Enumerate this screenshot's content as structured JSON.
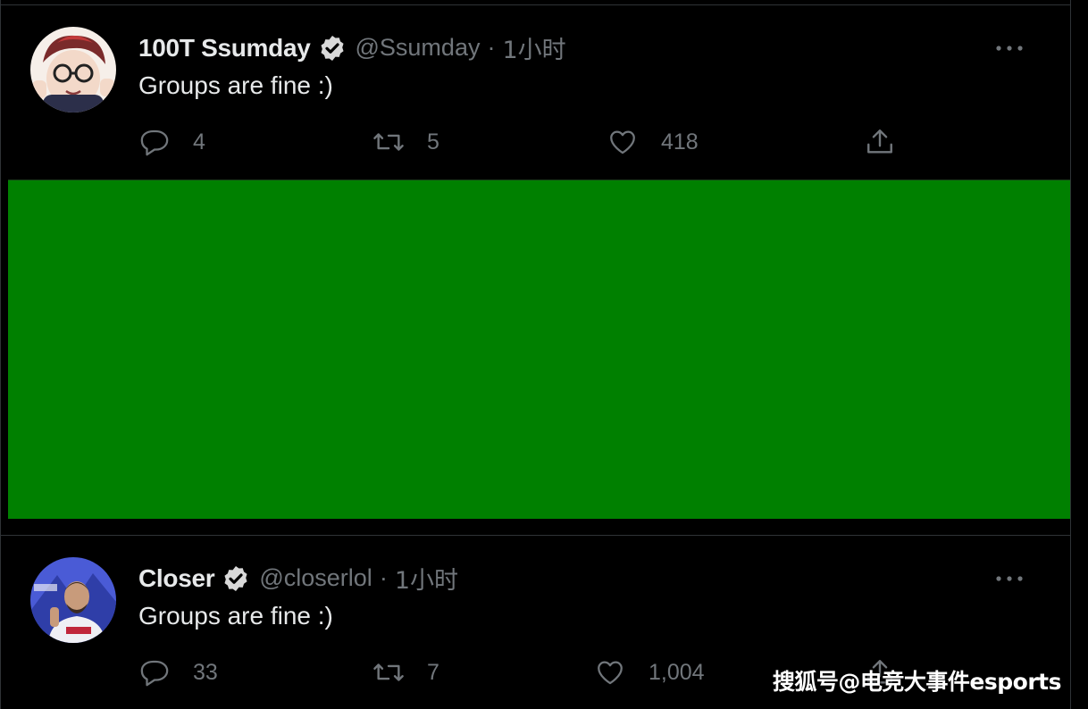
{
  "tweets": [
    {
      "name": "100T Ssumday",
      "handle": "@Ssumday",
      "separator": "·",
      "time": "1小时",
      "text": "Groups are fine :)",
      "replies": "4",
      "retweets": "5",
      "likes": "418",
      "avatar_colors": [
        "#f1e4dc",
        "#6b2b2b"
      ]
    },
    {
      "name": "Closer",
      "handle": "@closerlol",
      "separator": "·",
      "time": "1小时",
      "text": "Groups are fine :)",
      "replies": "33",
      "retweets": "7",
      "likes": "1,004",
      "avatar_colors": [
        "#3a4fd0",
        "#e8e8ee"
      ]
    }
  ],
  "media": {
    "color": "#008000"
  },
  "watermark": "搜狐号@电竞大事件esports",
  "colors": {
    "background": "#000000",
    "text": "#e7e9ea",
    "muted": "#71767b",
    "border": "#2f3336"
  }
}
